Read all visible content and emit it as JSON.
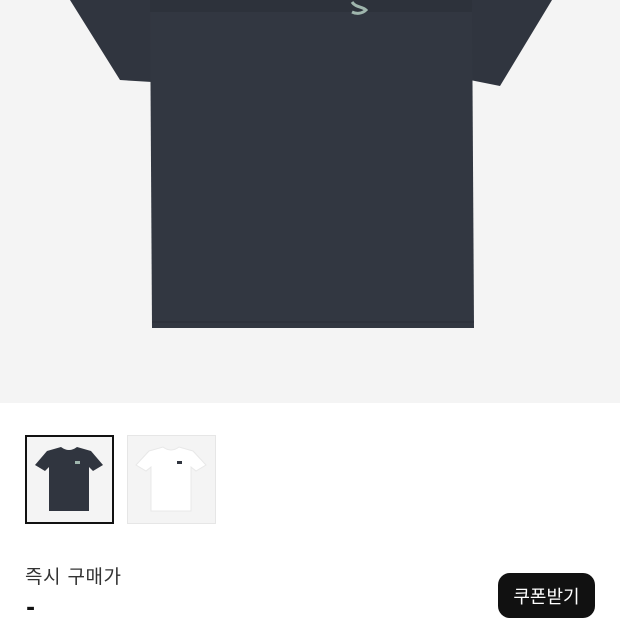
{
  "product": {
    "image_icon": "navy-tshirt-image",
    "colors": {
      "navy": "#30353f",
      "white": "#ffffff",
      "logo_accent": "#9fb6ad"
    }
  },
  "thumbnails": [
    {
      "icon": "navy-tshirt-thumbnail",
      "selected": true
    },
    {
      "icon": "white-tshirt-thumbnail",
      "selected": false
    }
  ],
  "price": {
    "label": "즉시 구매가",
    "value": "-"
  },
  "coupon_button": {
    "label": "쿠폰받기"
  }
}
